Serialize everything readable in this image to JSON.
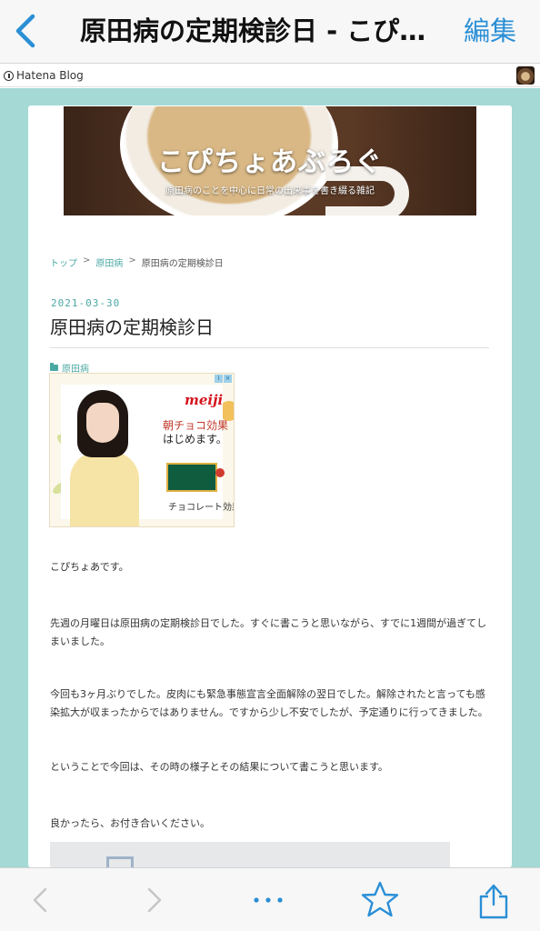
{
  "navbar": {
    "title": "原田病の定期検診日 - こぴ…",
    "edit_label": "編集"
  },
  "hatena": {
    "logo_label": "Hatena Blog"
  },
  "blog": {
    "banner_title": "こぴちょあぶろぐ",
    "banner_subtitle": "原田病のことを中心に日常の出来事を書き綴る雑記"
  },
  "breadcrumb": {
    "items": [
      "トップ",
      "原田病",
      "原田病の定期検診日"
    ],
    "separator": ">"
  },
  "entry": {
    "date": "2021-03-30",
    "title": "原田病の定期検診日",
    "category": "原田病",
    "paragraphs": [
      "こぴちょあです。",
      "先週の月曜日は原田病の定期検診日でした。すぐに書こうと思いながら、すでに1週間が過ぎてしまいました。",
      "今回も3ヶ月ぶりでした。皮肉にも緊急事態宣言全面解除の翌日でした。解除されたと言っても感染拡大が収まったからではありません。ですから少し不安でしたが、予定通りに行ってきました。",
      "ということで今回は、その時の様子とその結果について書こうと思います。",
      "良かったら、お付き合いください。"
    ]
  },
  "ad": {
    "brand": "meiji",
    "line1": "朝チョコ効果",
    "line2": "はじめます。",
    "line3": "チョコレート効果"
  },
  "toolbar": {
    "icons": [
      "chevron-left-icon",
      "chevron-right-icon",
      "more-icon",
      "star-icon",
      "share-icon"
    ]
  },
  "colors": {
    "accent_blue": "#2a8fd6",
    "page_teal": "#a4d9d6",
    "link_teal": "#4aa8a3"
  }
}
